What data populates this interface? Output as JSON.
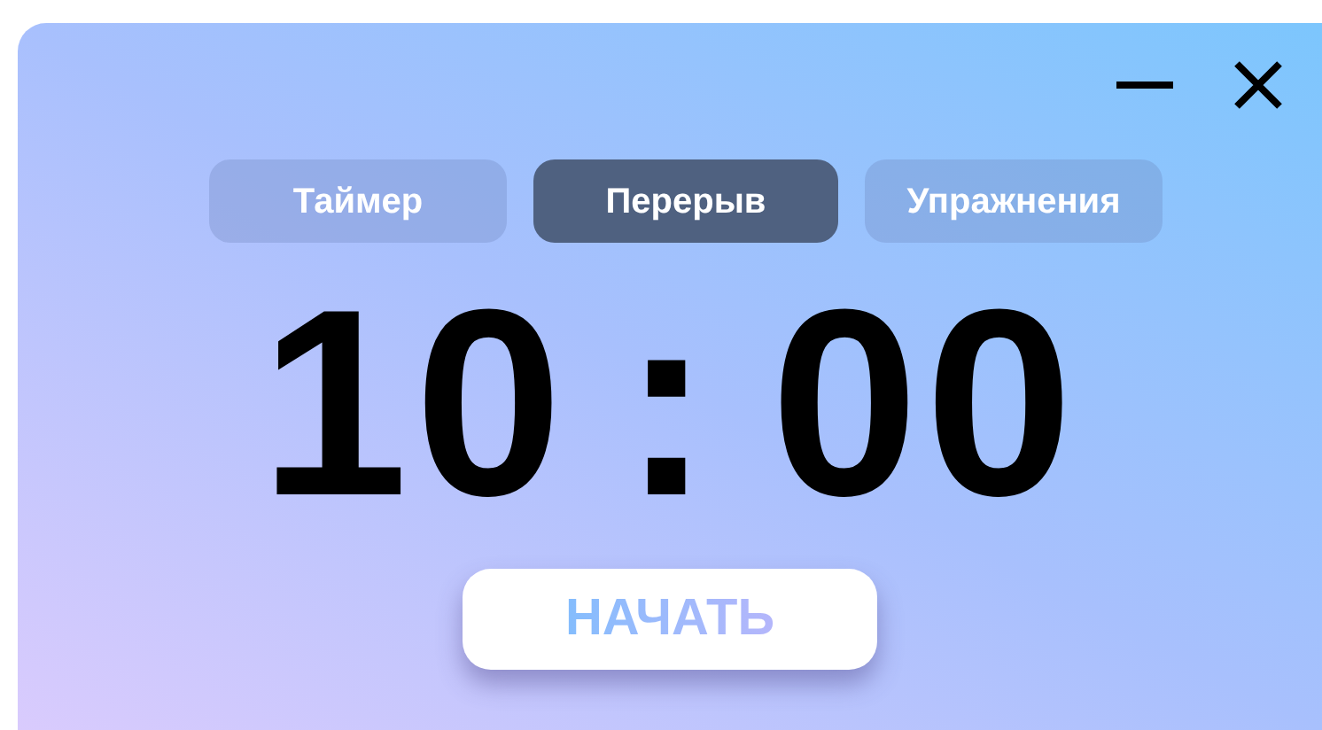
{
  "tabs": [
    {
      "label": "Таймер",
      "selected": false
    },
    {
      "label": "Перерыв",
      "selected": true
    },
    {
      "label": "Упражнения",
      "selected": false
    }
  ],
  "timer": {
    "minutes": "10",
    "separator": ":",
    "seconds": "00"
  },
  "start_button": {
    "label": "НАЧАТЬ"
  }
}
